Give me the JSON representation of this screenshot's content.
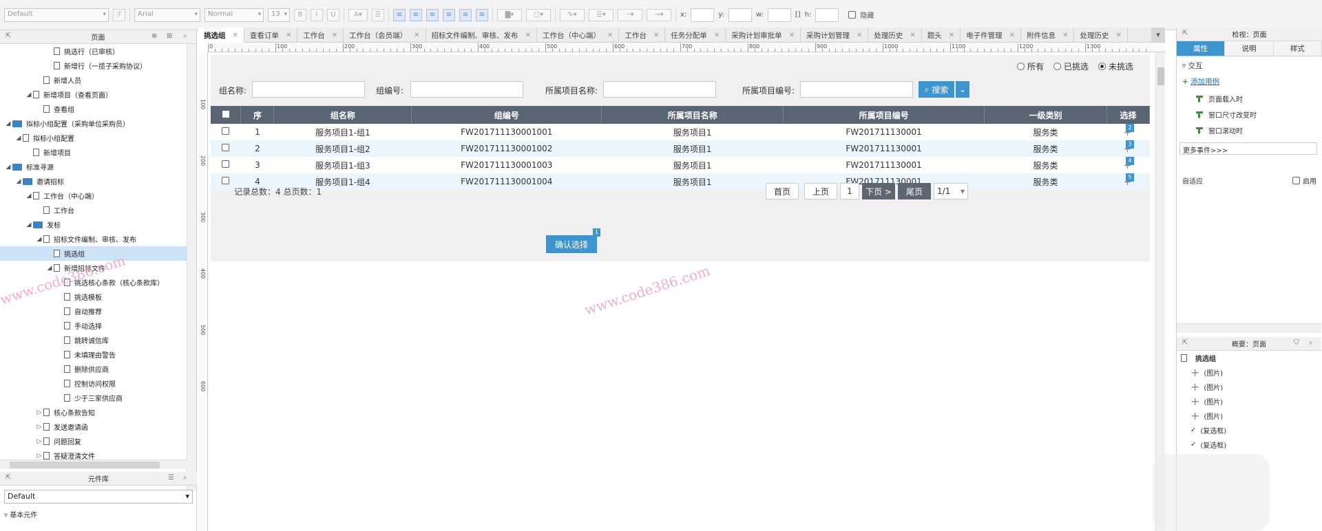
{
  "toolbar": {
    "style_select": "Default",
    "font_select": "Arial",
    "weight_select": "Normal",
    "size_select": "13",
    "x_label": "x:",
    "y_label": "y:",
    "w_label": "w:",
    "h_label": "h:",
    "hide_label": "隐藏"
  },
  "pages_panel": {
    "title": "页面",
    "items": [
      {
        "label": "挑选行（已审核）",
        "depth": 4,
        "type": "page",
        "toggle": ""
      },
      {
        "label": "新增行（一揽子采购协议）",
        "depth": 4,
        "type": "page",
        "toggle": ""
      },
      {
        "label": "新增人员",
        "depth": 3,
        "type": "page",
        "toggle": ""
      },
      {
        "label": "新增项目（查看页面）",
        "depth": 2,
        "type": "page",
        "toggle": "◢"
      },
      {
        "label": "查看组",
        "depth": 3,
        "type": "page",
        "toggle": ""
      },
      {
        "label": "拟标小组配置（采购单位采购员）",
        "depth": 0,
        "type": "folder",
        "toggle": "◢"
      },
      {
        "label": "拟标小组配置",
        "depth": 1,
        "type": "page",
        "toggle": "◢"
      },
      {
        "label": "新增项目",
        "depth": 2,
        "type": "page",
        "toggle": ""
      },
      {
        "label": "标准寻源",
        "depth": 0,
        "type": "folder",
        "toggle": "◢"
      },
      {
        "label": "邀请招标",
        "depth": 1,
        "type": "folder",
        "toggle": "◢"
      },
      {
        "label": "工作台（中心端）",
        "depth": 2,
        "type": "page",
        "toggle": "◢"
      },
      {
        "label": "工作台",
        "depth": 3,
        "type": "page",
        "toggle": ""
      },
      {
        "label": "发标",
        "depth": 2,
        "type": "folder",
        "toggle": "◢"
      },
      {
        "label": "招标文件编制、审核、发布",
        "depth": 3,
        "type": "page",
        "toggle": "◢"
      },
      {
        "label": "挑选组",
        "depth": 4,
        "type": "page",
        "toggle": "",
        "selected": true
      },
      {
        "label": "新增招标文件",
        "depth": 4,
        "type": "page",
        "toggle": "◢"
      },
      {
        "label": "挑选核心条款（核心条款库）",
        "depth": 5,
        "type": "page",
        "toggle": ""
      },
      {
        "label": "挑选模板",
        "depth": 5,
        "type": "page",
        "toggle": ""
      },
      {
        "label": "自动推荐",
        "depth": 5,
        "type": "page",
        "toggle": ""
      },
      {
        "label": "手动选择",
        "depth": 5,
        "type": "page",
        "toggle": ""
      },
      {
        "label": "跳转诚信库",
        "depth": 5,
        "type": "page",
        "toggle": ""
      },
      {
        "label": "未填理由警告",
        "depth": 5,
        "type": "page",
        "toggle": ""
      },
      {
        "label": "删除供应商",
        "depth": 5,
        "type": "page",
        "toggle": ""
      },
      {
        "label": "控制访问权限",
        "depth": 5,
        "type": "page",
        "toggle": ""
      },
      {
        "label": "少于三家供应商",
        "depth": 5,
        "type": "page",
        "toggle": ""
      },
      {
        "label": "核心条款告知",
        "depth": 3,
        "type": "page",
        "toggle": "▷"
      },
      {
        "label": "发送邀请函",
        "depth": 3,
        "type": "page",
        "toggle": "▷"
      },
      {
        "label": "问题回复",
        "depth": 3,
        "type": "page",
        "toggle": "▷"
      },
      {
        "label": "答疑澄清文件",
        "depth": 3,
        "type": "page",
        "toggle": "▷"
      }
    ]
  },
  "library_panel": {
    "title": "元件库",
    "select": "Default",
    "item": "基本元件"
  },
  "tabs": [
    "挑选组",
    "查看订单",
    "工作台",
    "工作台（会员端）",
    "招标文件编制、审核、发布",
    "工作台（中心端）",
    "工作台",
    "任务分配单",
    "采购计划审批单",
    "采购计划管理",
    "处理历史",
    "题头",
    "电子件管理",
    "附件信息",
    "处理历史"
  ],
  "ruler_marks": [
    "0",
    "100",
    "200",
    "300",
    "400",
    "500",
    "600",
    "700",
    "800",
    "900",
    "1000",
    "1100",
    "1200",
    "1300"
  ],
  "vruler_marks": [
    "100",
    "200",
    "300",
    "400",
    "500",
    "600"
  ],
  "page": {
    "radio_options": [
      {
        "label": "所有",
        "checked": false
      },
      {
        "label": "已挑选",
        "checked": false
      },
      {
        "label": "未挑选",
        "checked": true
      }
    ],
    "filters": {
      "group_name_label": "组名称:",
      "group_code_label": "组编号:",
      "project_name_label": "所属项目名称:",
      "project_code_label": "所属项目编号:",
      "search_button": "搜索"
    },
    "table": {
      "headers": [
        "",
        "序",
        "组名称",
        "组编号",
        "所属项目名称",
        "所属项目编号",
        "一级类别",
        "选择"
      ],
      "rows": [
        {
          "seq": "1",
          "name": "服务项目1-组1",
          "code": "FW201711130001001",
          "project": "服务项目1",
          "project_code": "FW201711130001",
          "category": "服务类",
          "badge": "2"
        },
        {
          "seq": "2",
          "name": "服务项目1-组2",
          "code": "FW201711130001002",
          "project": "服务项目1",
          "project_code": "FW201711130001",
          "category": "服务类",
          "badge": "3"
        },
        {
          "seq": "3",
          "name": "服务项目1-组3",
          "code": "FW201711130001003",
          "project": "服务项目1",
          "project_code": "FW201711130001",
          "category": "服务类",
          "badge": "4"
        },
        {
          "seq": "4",
          "name": "服务项目1-组4",
          "code": "FW201711130001004",
          "project": "服务项目1",
          "project_code": "FW201711130001",
          "category": "服务类",
          "badge": "5"
        }
      ]
    },
    "pager": {
      "summary": "记录总数：4   总页数：1",
      "first": "首页",
      "prev": "上页",
      "current": "1",
      "next": "下页 >",
      "last": "尾页",
      "page_select": "1/1"
    },
    "confirm_button": "确认选择",
    "confirm_badge": "1",
    "watermark": "www.code386.com"
  },
  "inspector": {
    "title": "检视：页面",
    "tabs": [
      "属性",
      "说明",
      "样式"
    ],
    "section": "交互",
    "add_case": "添加用例",
    "events": [
      "页面载入时",
      "窗口尺寸改变时",
      "窗口滚动时"
    ],
    "more_events": "更多事件>>>",
    "adaptive_label": "自适应",
    "enable_label": "启用"
  },
  "outline": {
    "title": "概要：页面",
    "root": "挑选组",
    "items": [
      {
        "label": "(图片)",
        "icon": "plus"
      },
      {
        "label": "(图片)",
        "icon": "plus"
      },
      {
        "label": "(图片)",
        "icon": "plus"
      },
      {
        "label": "(图片)",
        "icon": "plus"
      },
      {
        "label": "(复选框)",
        "icon": "check"
      },
      {
        "label": "(复选框)",
        "icon": "check"
      }
    ]
  },
  "colors": {
    "accent": "#3d95d0",
    "header_bg": "#5a6573",
    "row_alt": "#eaf6fb",
    "watermark": "#f3a1b9"
  }
}
